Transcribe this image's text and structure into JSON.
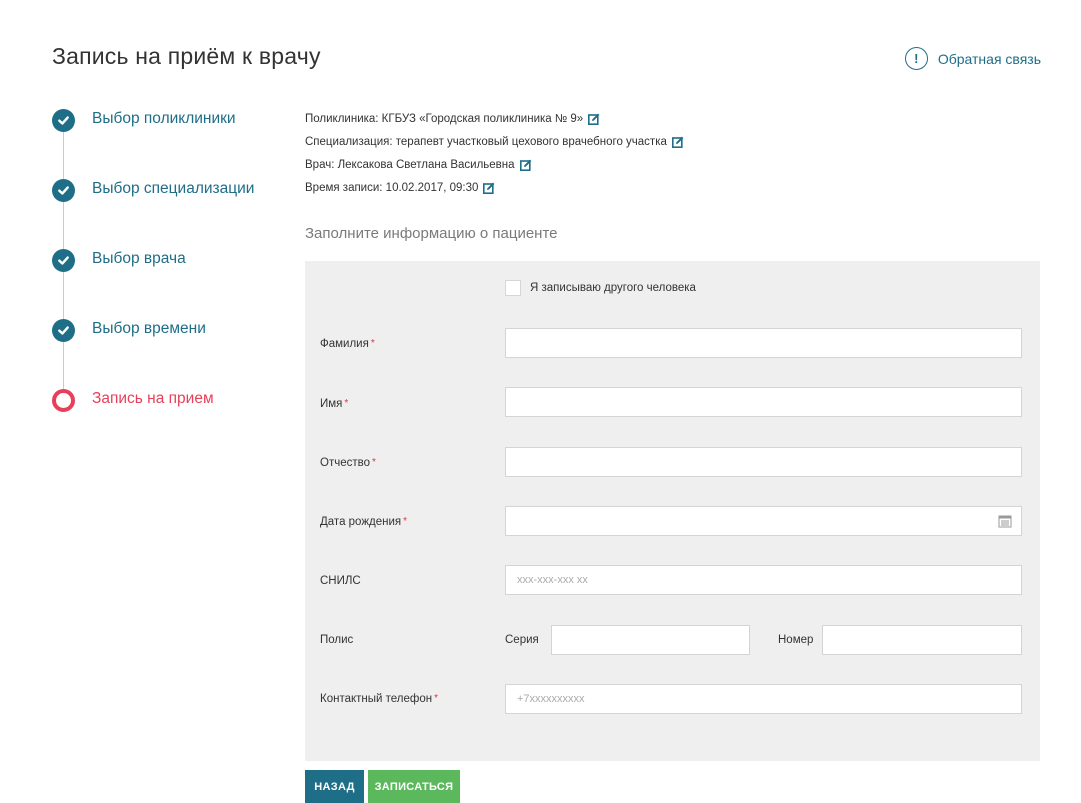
{
  "header": {
    "title": "Запись на приём к врачу",
    "feedback_label": "Обратная связь",
    "feedback_icon_glyph": "!"
  },
  "steps": [
    {
      "label": "Выбор поликлиники",
      "status": "done"
    },
    {
      "label": "Выбор специализации",
      "status": "done"
    },
    {
      "label": "Выбор врача",
      "status": "done"
    },
    {
      "label": "Выбор времени",
      "status": "done"
    },
    {
      "label": "Запись на прием",
      "status": "active"
    }
  ],
  "summary": {
    "clinic": "Поликлиника: КГБУЗ «Городская поликлиника № 9»",
    "specialization": "Специализация: терапевт участковый цехового врачебного участка",
    "doctor": "Врач: Лексакова Светлана Васильевна",
    "time": "Время записи: 10.02.2017, 09:30"
  },
  "form": {
    "section_title": "Заполните информацию о пациенте",
    "other_person_label": "Я записываю другого человека",
    "required_mark": "*",
    "lastname_label": "Фамилия",
    "firstname_label": "Имя",
    "patronymic_label": "Отчество",
    "birthdate_label": "Дата рождения",
    "snils_label": "СНИЛС",
    "snils_placeholder": "xxx-xxx-xxx xx",
    "policy_label": "Полис",
    "policy_series_label": "Серия",
    "policy_number_label": "Номер",
    "phone_label": "Контактный телефон",
    "phone_placeholder": "+7xxxxxxxxxx"
  },
  "buttons": {
    "back": "НАЗАД",
    "submit": "ЗАПИСАТЬСЯ"
  },
  "colors": {
    "primary": "#1e6e88",
    "active_step": "#e8405a",
    "submit": "#5cb85c",
    "required": "#d9363e",
    "panel": "#efefef"
  }
}
